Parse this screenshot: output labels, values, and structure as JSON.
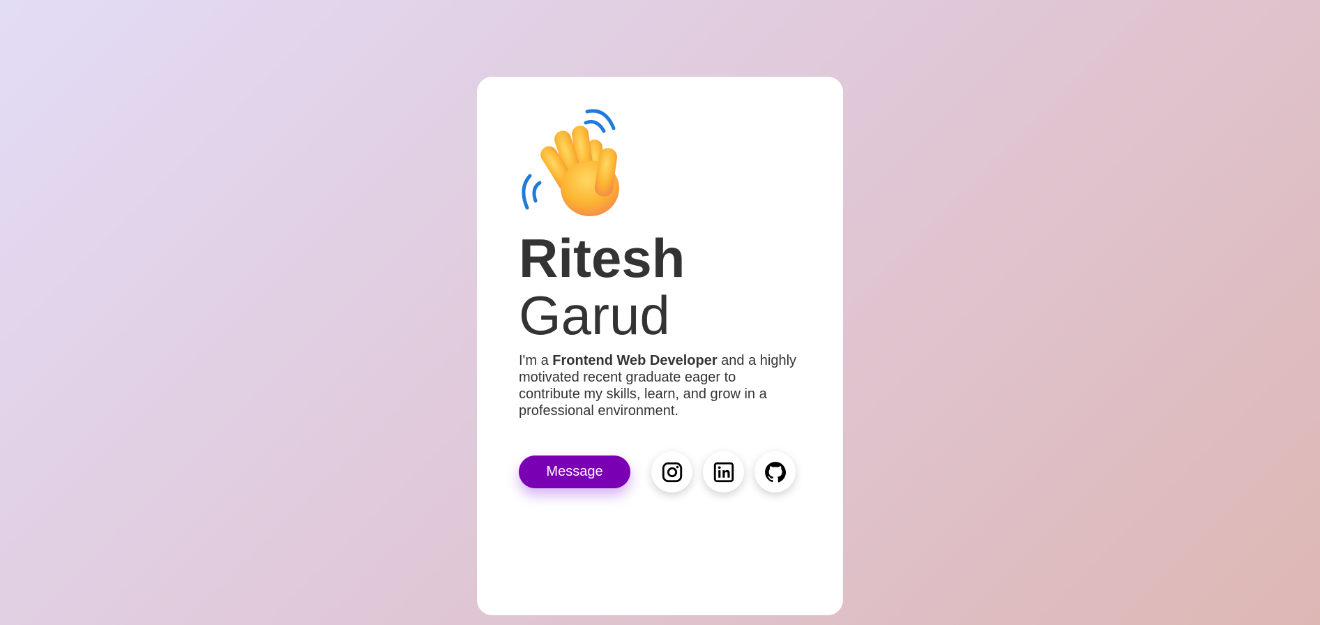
{
  "profile": {
    "first_name": "Ritesh",
    "last_name": "Garud",
    "bio_prefix": "I'm a ",
    "bio_role": "Frontend Web Developer",
    "bio_suffix": " and a highly motivated recent graduate eager to contribute my skills, learn, and grow in a professional environment."
  },
  "actions": {
    "message_label": "Message"
  },
  "social": [
    {
      "icon": "instagram-icon"
    },
    {
      "icon": "linkedin-icon"
    },
    {
      "icon": "github-icon"
    }
  ],
  "colors": {
    "accent": "#7a00b4",
    "text": "#333333",
    "card": "#ffffff"
  }
}
